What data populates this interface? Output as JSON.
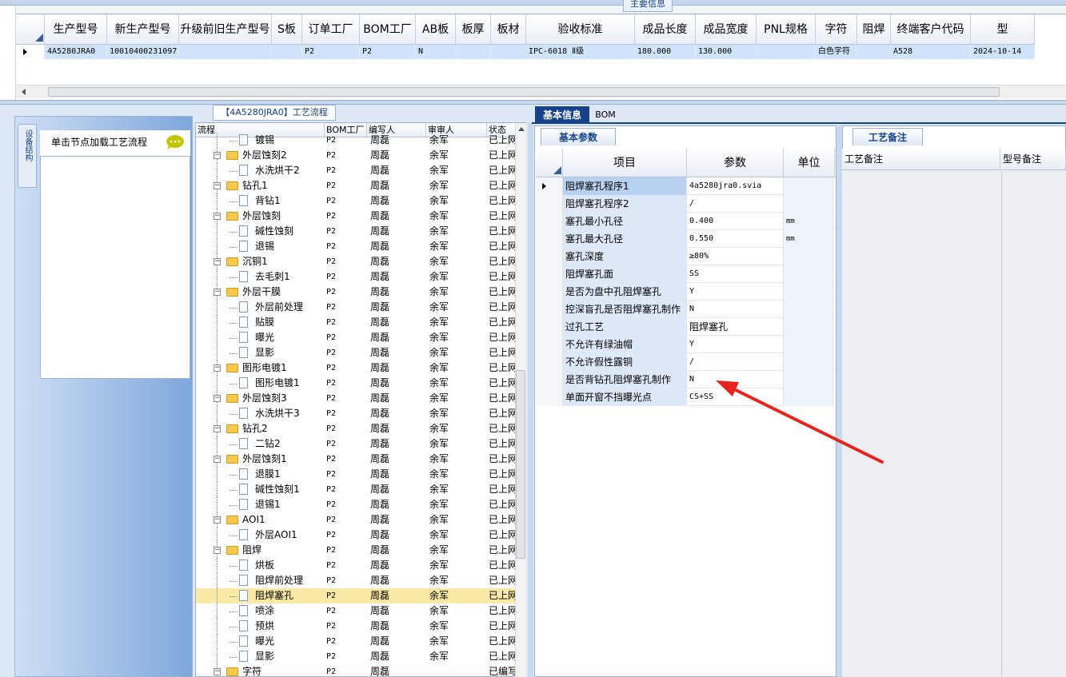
{
  "top": {
    "caption": "主要信息",
    "columns": [
      "生产型号",
      "新生产型号",
      "升级前旧生产型号",
      "S板",
      "订单工厂",
      "BOM工厂",
      "AB板",
      "板厚",
      "板材",
      "验收标准",
      "成品长度",
      "成品宽度",
      "PNL规格",
      "字符",
      "阻焊",
      "终端客户代码",
      "型"
    ],
    "row": [
      "4A5280JRA0",
      "10010400231097",
      "",
      "",
      "P2",
      "P2",
      "N",
      "",
      "",
      "IPC-6018 Ⅱ级",
      "180.000",
      "130.000",
      "",
      "白色字符",
      "",
      "A528",
      "2024-10-14"
    ]
  },
  "left": {
    "vtab_label": "设备结构",
    "hint": "单击节点加载工艺流程"
  },
  "tree": {
    "caption": "【4A5280JRA0】工艺流程",
    "headers": [
      "流程",
      "BOM工厂",
      "编写人",
      "审审人",
      "状态"
    ],
    "rows": [
      {
        "name": "镀锡",
        "level": 2,
        "folder": false,
        "factory": "P2",
        "writer": "周磊",
        "reviewer": "余军",
        "status": "已上网"
      },
      {
        "name": "外层蚀刻2",
        "level": 1,
        "folder": true,
        "factory": "P2",
        "writer": "周磊",
        "reviewer": "余军",
        "status": "已上网"
      },
      {
        "name": "水洗烘干2",
        "level": 2,
        "folder": false,
        "factory": "P2",
        "writer": "周磊",
        "reviewer": "余军",
        "status": "已上网"
      },
      {
        "name": "钻孔1",
        "level": 1,
        "folder": true,
        "factory": "P2",
        "writer": "周磊",
        "reviewer": "余军",
        "status": "已上网"
      },
      {
        "name": "背钻1",
        "level": 2,
        "folder": false,
        "factory": "P2",
        "writer": "周磊",
        "reviewer": "余军",
        "status": "已上网"
      },
      {
        "name": "外层蚀刻",
        "level": 1,
        "folder": true,
        "factory": "P2",
        "writer": "周磊",
        "reviewer": "余军",
        "status": "已上网"
      },
      {
        "name": "碱性蚀刻",
        "level": 2,
        "folder": false,
        "factory": "P2",
        "writer": "周磊",
        "reviewer": "余军",
        "status": "已上网"
      },
      {
        "name": "退锡",
        "level": 2,
        "folder": false,
        "factory": "P2",
        "writer": "周磊",
        "reviewer": "余军",
        "status": "已上网"
      },
      {
        "name": "沉铜1",
        "level": 1,
        "folder": true,
        "factory": "P2",
        "writer": "周磊",
        "reviewer": "余军",
        "status": "已上网"
      },
      {
        "name": "去毛刺1",
        "level": 2,
        "folder": false,
        "factory": "P2",
        "writer": "周磊",
        "reviewer": "余军",
        "status": "已上网"
      },
      {
        "name": "外层干膜",
        "level": 1,
        "folder": true,
        "factory": "P2",
        "writer": "周磊",
        "reviewer": "余军",
        "status": "已上网"
      },
      {
        "name": "外层前处理",
        "level": 2,
        "folder": false,
        "factory": "P2",
        "writer": "周磊",
        "reviewer": "余军",
        "status": "已上网"
      },
      {
        "name": "贴膜",
        "level": 2,
        "folder": false,
        "factory": "P2",
        "writer": "周磊",
        "reviewer": "余军",
        "status": "已上网"
      },
      {
        "name": "曝光",
        "level": 2,
        "folder": false,
        "factory": "P2",
        "writer": "周磊",
        "reviewer": "余军",
        "status": "已上网"
      },
      {
        "name": "显影",
        "level": 2,
        "folder": false,
        "factory": "P2",
        "writer": "周磊",
        "reviewer": "余军",
        "status": "已上网"
      },
      {
        "name": "图形电镀1",
        "level": 1,
        "folder": true,
        "factory": "P2",
        "writer": "周磊",
        "reviewer": "余军",
        "status": "已上网"
      },
      {
        "name": "图形电镀1",
        "level": 2,
        "folder": false,
        "factory": "P2",
        "writer": "周磊",
        "reviewer": "余军",
        "status": "已上网"
      },
      {
        "name": "外层蚀刻3",
        "level": 1,
        "folder": true,
        "factory": "P2",
        "writer": "周磊",
        "reviewer": "余军",
        "status": "已上网"
      },
      {
        "name": "水洗烘干3",
        "level": 2,
        "folder": false,
        "factory": "P2",
        "writer": "周磊",
        "reviewer": "余军",
        "status": "已上网"
      },
      {
        "name": "钻孔2",
        "level": 1,
        "folder": true,
        "factory": "P2",
        "writer": "周磊",
        "reviewer": "余军",
        "status": "已上网"
      },
      {
        "name": "二钻2",
        "level": 2,
        "folder": false,
        "factory": "P2",
        "writer": "周磊",
        "reviewer": "余军",
        "status": "已上网"
      },
      {
        "name": "外层蚀刻1",
        "level": 1,
        "folder": true,
        "factory": "P2",
        "writer": "周磊",
        "reviewer": "余军",
        "status": "已上网"
      },
      {
        "name": "退膜1",
        "level": 2,
        "folder": false,
        "factory": "P2",
        "writer": "周磊",
        "reviewer": "余军",
        "status": "已上网"
      },
      {
        "name": "碱性蚀刻1",
        "level": 2,
        "folder": false,
        "factory": "P2",
        "writer": "周磊",
        "reviewer": "余军",
        "status": "已上网"
      },
      {
        "name": "退锡1",
        "level": 2,
        "folder": false,
        "factory": "P2",
        "writer": "周磊",
        "reviewer": "余军",
        "status": "已上网"
      },
      {
        "name": "AOI1",
        "level": 1,
        "folder": true,
        "factory": "P2",
        "writer": "周磊",
        "reviewer": "余军",
        "status": "已上网"
      },
      {
        "name": "外层AOI1",
        "level": 2,
        "folder": false,
        "factory": "P2",
        "writer": "周磊",
        "reviewer": "余军",
        "status": "已上网"
      },
      {
        "name": "阻焊",
        "level": 1,
        "folder": true,
        "factory": "P2",
        "writer": "周磊",
        "reviewer": "余军",
        "status": "已上网"
      },
      {
        "name": "烘板",
        "level": 2,
        "folder": false,
        "factory": "P2",
        "writer": "周磊",
        "reviewer": "余军",
        "status": "已上网"
      },
      {
        "name": "阻焊前处理",
        "level": 2,
        "folder": false,
        "factory": "P2",
        "writer": "周磊",
        "reviewer": "余军",
        "status": "已上网"
      },
      {
        "name": "阻焊塞孔",
        "level": 2,
        "folder": false,
        "selected": true,
        "factory": "P2",
        "writer": "周磊",
        "reviewer": "余军",
        "status": "已上网"
      },
      {
        "name": "喷涂",
        "level": 2,
        "folder": false,
        "factory": "P2",
        "writer": "周磊",
        "reviewer": "余军",
        "status": "已上网"
      },
      {
        "name": "预烘",
        "level": 2,
        "folder": false,
        "factory": "P2",
        "writer": "周磊",
        "reviewer": "余军",
        "status": "已上网"
      },
      {
        "name": "曝光",
        "level": 2,
        "folder": false,
        "factory": "P2",
        "writer": "周磊",
        "reviewer": "余军",
        "status": "已上网"
      },
      {
        "name": "显影",
        "level": 2,
        "folder": false,
        "factory": "P2",
        "writer": "周磊",
        "reviewer": "余军",
        "status": "已上网"
      },
      {
        "name": "字符",
        "level": 1,
        "folder": true,
        "factory": "P2",
        "writer": "周磊",
        "reviewer": "",
        "status": "已编写"
      }
    ]
  },
  "params": {
    "tabs": [
      "基本信息",
      "BOM"
    ],
    "subtab": "基本参数",
    "headers": [
      "项目",
      "参数",
      "单位"
    ],
    "rows": [
      {
        "item": "阻焊塞孔程序1",
        "value": "4a5280jra0.svia",
        "unit": ""
      },
      {
        "item": "阻焊塞孔程序2",
        "value": "/",
        "unit": ""
      },
      {
        "item": "塞孔最小孔径",
        "value": "0.400",
        "unit": "mm"
      },
      {
        "item": "塞孔最大孔径",
        "value": "0.550",
        "unit": "mm"
      },
      {
        "item": "塞孔深度",
        "value": "≥80%",
        "unit": ""
      },
      {
        "item": "阻焊塞孔面",
        "value": "SS",
        "unit": ""
      },
      {
        "item": "是否为盘中孔阻焊塞孔",
        "value": "Y",
        "unit": ""
      },
      {
        "item": "控深盲孔是否阻焊塞孔制作",
        "value": "N",
        "unit": ""
      },
      {
        "item": "过孔工艺",
        "value": "阻焊塞孔",
        "unit": ""
      },
      {
        "item": "不允许有绿油帽",
        "value": "Y",
        "unit": ""
      },
      {
        "item": "不允许假性露铜",
        "value": "/",
        "unit": ""
      },
      {
        "item": "是否背钻孔阻焊塞孔制作",
        "value": "N",
        "unit": ""
      },
      {
        "item": "单面开窗不挡曝光点",
        "value": "CS+SS",
        "unit": ""
      }
    ]
  },
  "remarks": {
    "tab": "工艺备注",
    "columns": [
      "工艺备注",
      "型号备注"
    ]
  },
  "colors": {
    "accent": "#15428b",
    "selected_row": "#fbe9a6",
    "grid_row": "#cfe3fb",
    "arrow": "#e8231e"
  }
}
